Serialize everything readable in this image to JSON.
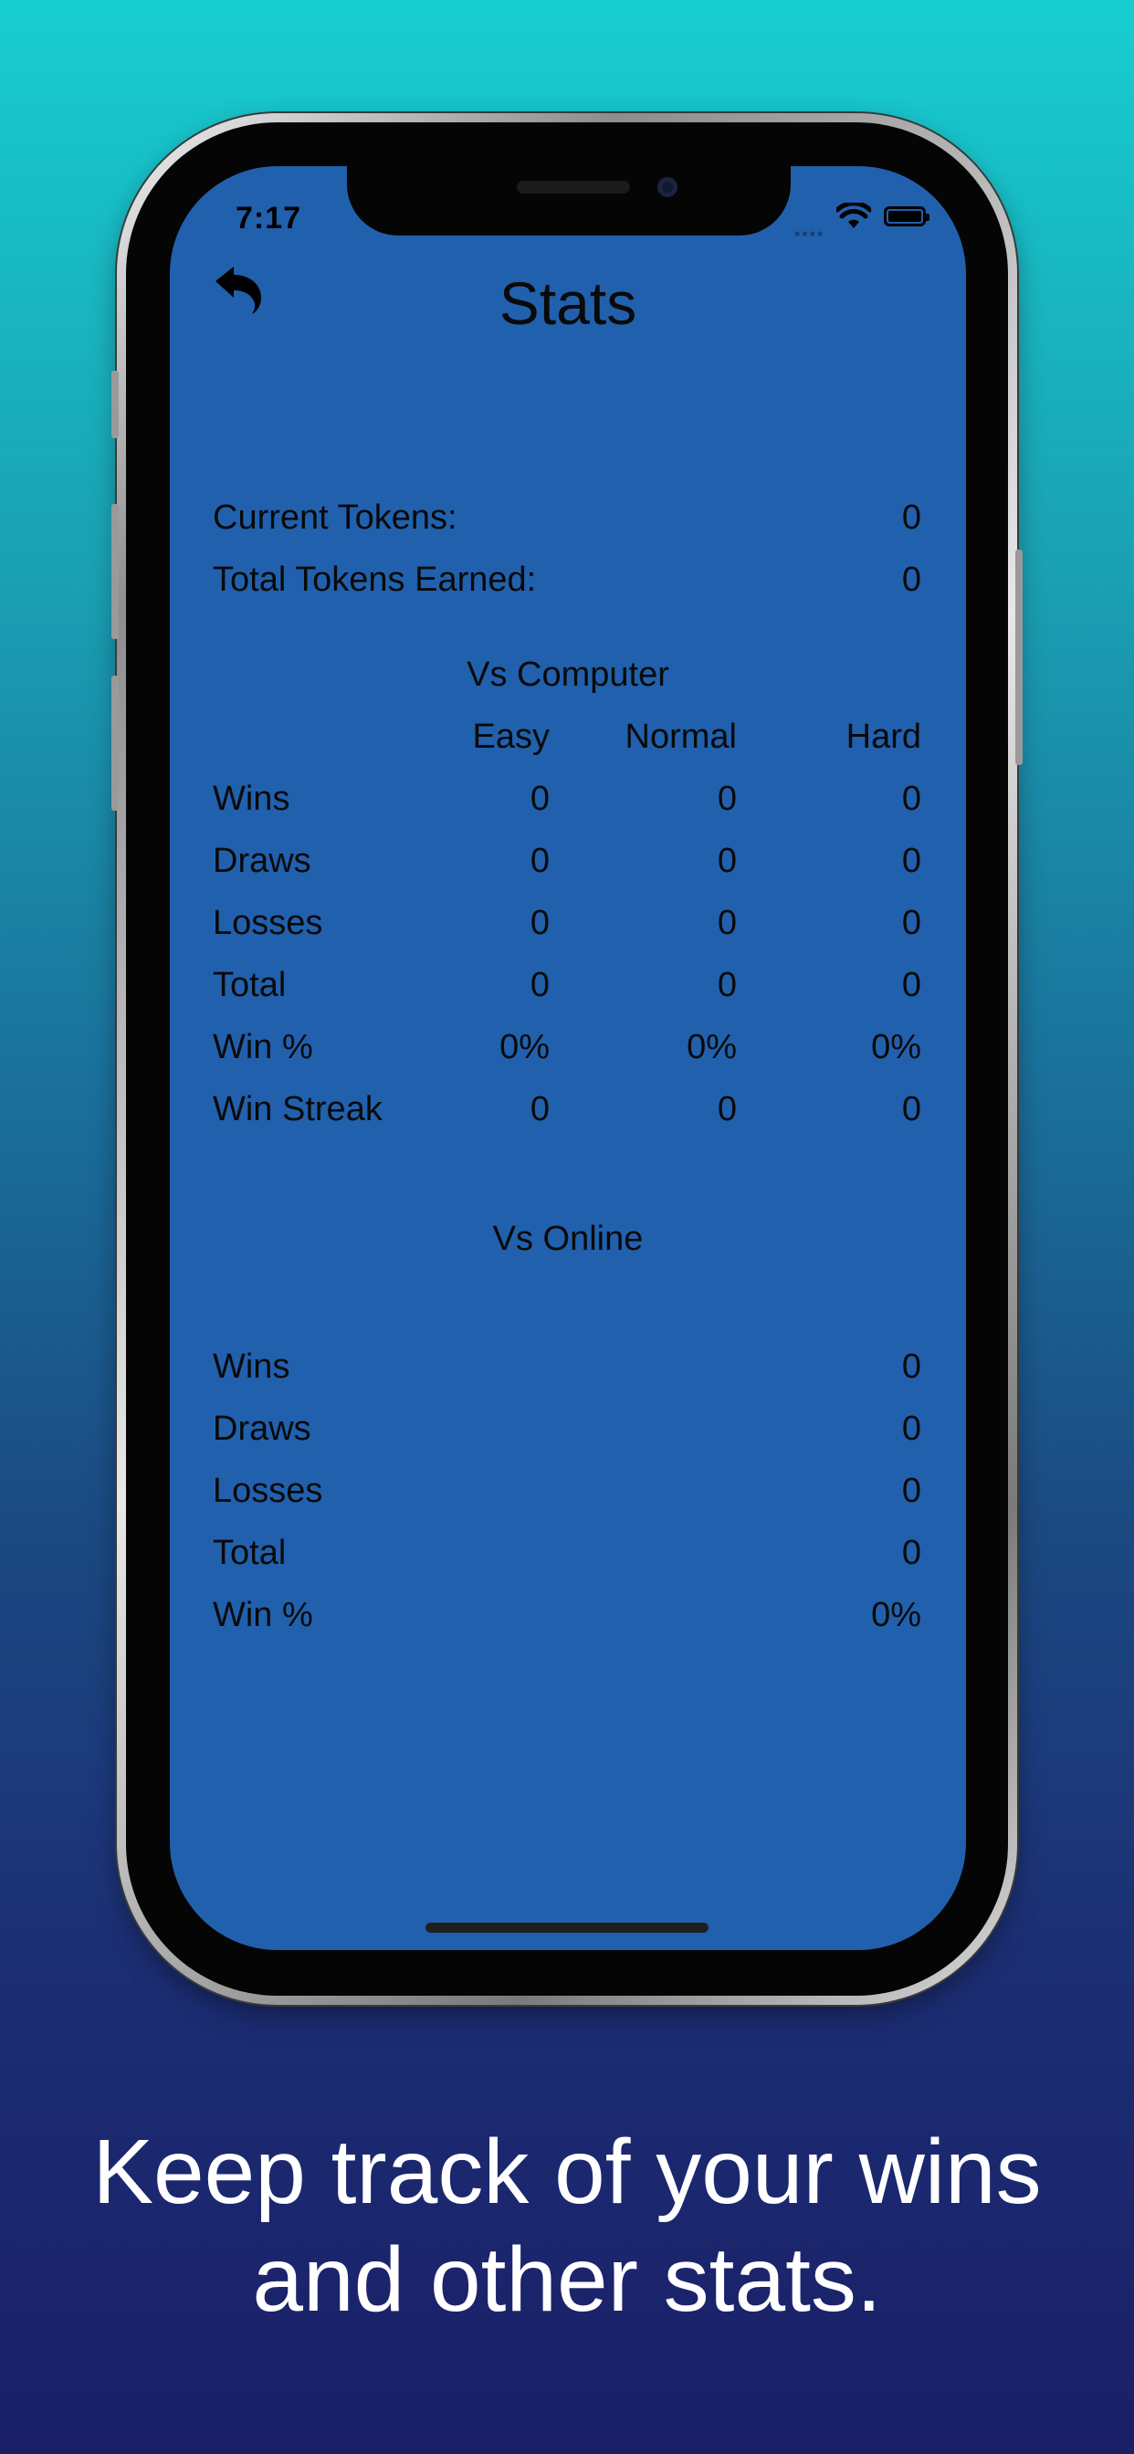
{
  "status_bar": {
    "time": "7:17"
  },
  "header": {
    "title": "Stats"
  },
  "tokens": [
    {
      "label": "Current Tokens:",
      "value": "0"
    },
    {
      "label": "Total Tokens Earned:",
      "value": "0"
    }
  ],
  "vs_computer": {
    "title": "Vs Computer",
    "columns": [
      "Easy",
      "Normal",
      "Hard"
    ],
    "rows": [
      {
        "label": "Wins",
        "values": [
          "0",
          "0",
          "0"
        ]
      },
      {
        "label": "Draws",
        "values": [
          "0",
          "0",
          "0"
        ]
      },
      {
        "label": "Losses",
        "values": [
          "0",
          "0",
          "0"
        ]
      },
      {
        "label": "Total",
        "values": [
          "0",
          "0",
          "0"
        ]
      },
      {
        "label": "Win %",
        "values": [
          "0%",
          "0%",
          "0%"
        ]
      },
      {
        "label": "Win Streak",
        "values": [
          "0",
          "0",
          "0"
        ]
      }
    ]
  },
  "vs_online": {
    "title": "Vs Online",
    "rows": [
      {
        "label": "Wins",
        "value": "0"
      },
      {
        "label": "Draws",
        "value": "0"
      },
      {
        "label": "Losses",
        "value": "0"
      },
      {
        "label": "Total",
        "value": "0"
      },
      {
        "label": "Win %",
        "value": "0%"
      }
    ]
  },
  "caption": {
    "line1": "Keep track of your wins",
    "line2": "and other stats."
  },
  "colors": {
    "screen_bg": "#2160ad",
    "gradient_top": "#17cdd0",
    "gradient_bottom": "#1a1f67",
    "text": "#0a0a0a"
  },
  "icons": [
    "back-arrow-icon",
    "wifi-icon",
    "battery-icon"
  ]
}
